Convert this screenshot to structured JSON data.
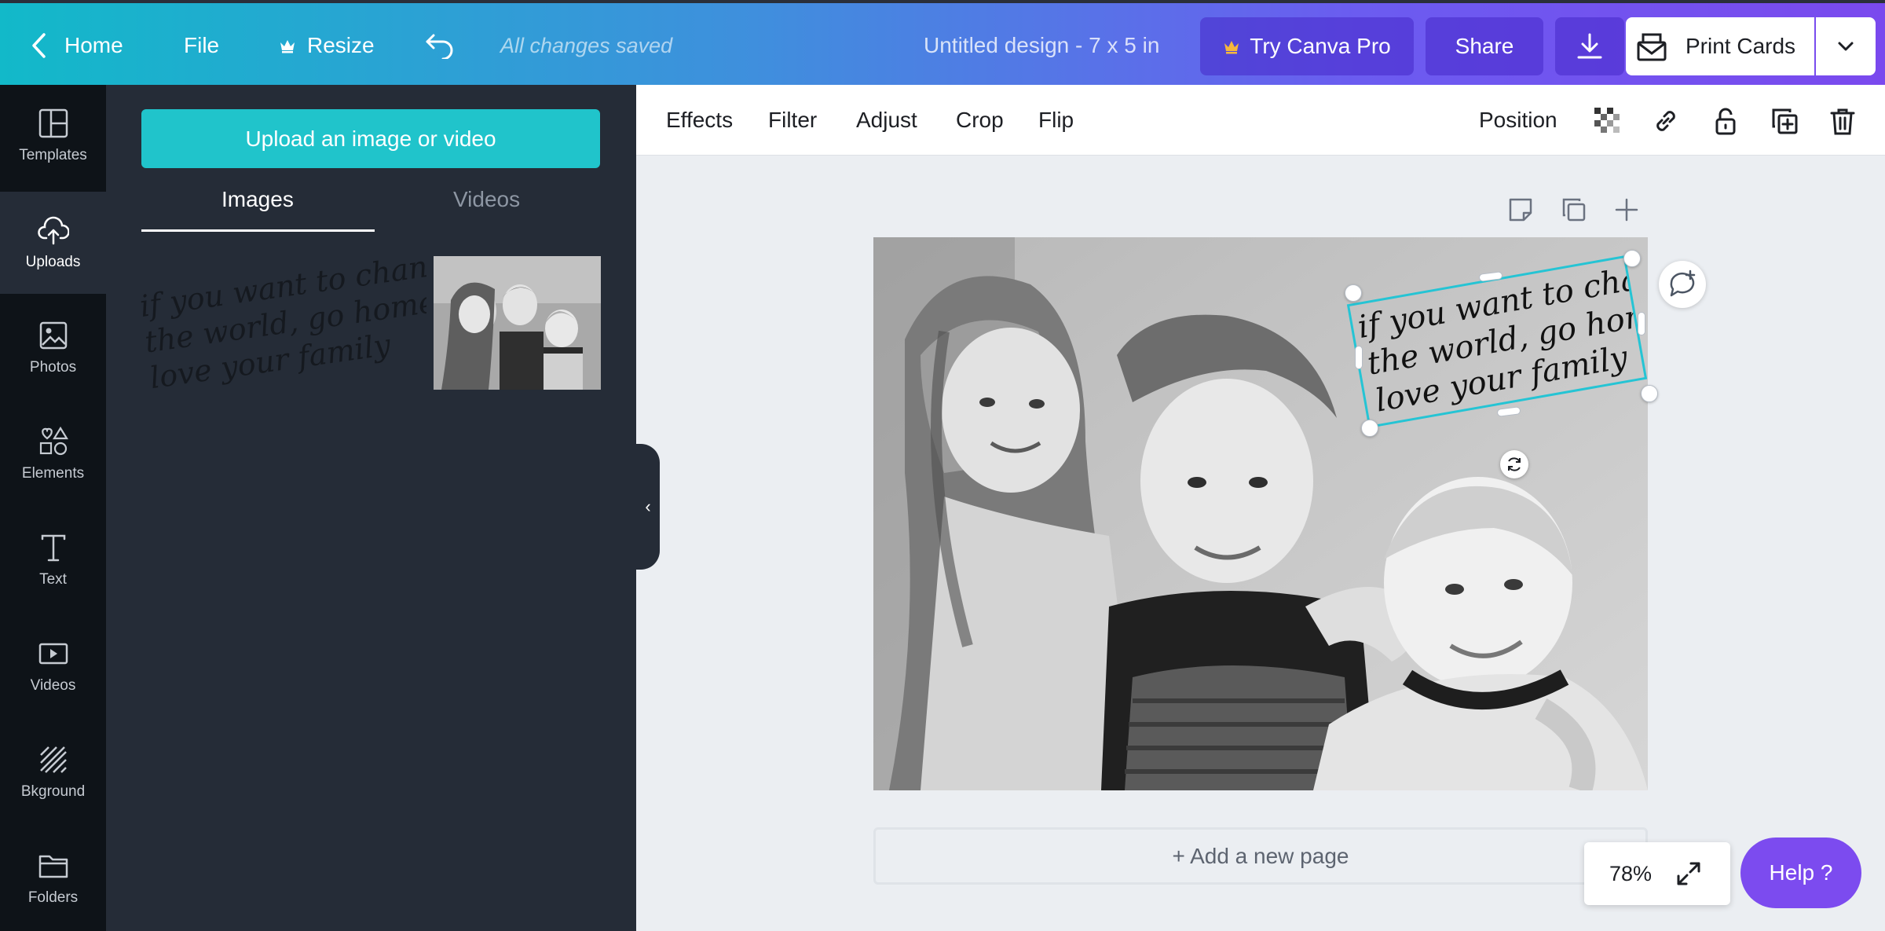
{
  "topbar": {
    "home_label": "Home",
    "file_label": "File",
    "resize_label": "Resize",
    "saved_status": "All changes saved",
    "design_title": "Untitled design - 7 x 5 in",
    "try_pro_label": "Try Canva Pro",
    "share_label": "Share",
    "print_label": "Print Cards"
  },
  "rail": {
    "items": [
      {
        "label": "Templates",
        "icon": "templates-icon"
      },
      {
        "label": "Uploads",
        "icon": "upload-icon"
      },
      {
        "label": "Photos",
        "icon": "photos-icon"
      },
      {
        "label": "Elements",
        "icon": "elements-icon"
      },
      {
        "label": "Text",
        "icon": "text-icon"
      },
      {
        "label": "Videos",
        "icon": "videos-icon"
      },
      {
        "label": "Bkground",
        "icon": "background-icon"
      },
      {
        "label": "Folders",
        "icon": "folder-icon"
      }
    ]
  },
  "panel": {
    "upload_button": "Upload an image or video",
    "tabs": [
      "Images",
      "Videos"
    ],
    "script_lines": [
      "if you want to change",
      "the world, go home +",
      "love your family"
    ]
  },
  "toolbar": {
    "effects": "Effects",
    "filter": "Filter",
    "adjust": "Adjust",
    "crop": "Crop",
    "flip": "Flip",
    "position": "Position"
  },
  "canvas": {
    "add_page": "+ Add a new page",
    "zoom": "78%",
    "help": "Help ?"
  },
  "colors": {
    "accent": "#20c4cb",
    "selection": "#25c4d4",
    "pro_purple": "#7c4bef",
    "crown": "#f6b73c"
  }
}
